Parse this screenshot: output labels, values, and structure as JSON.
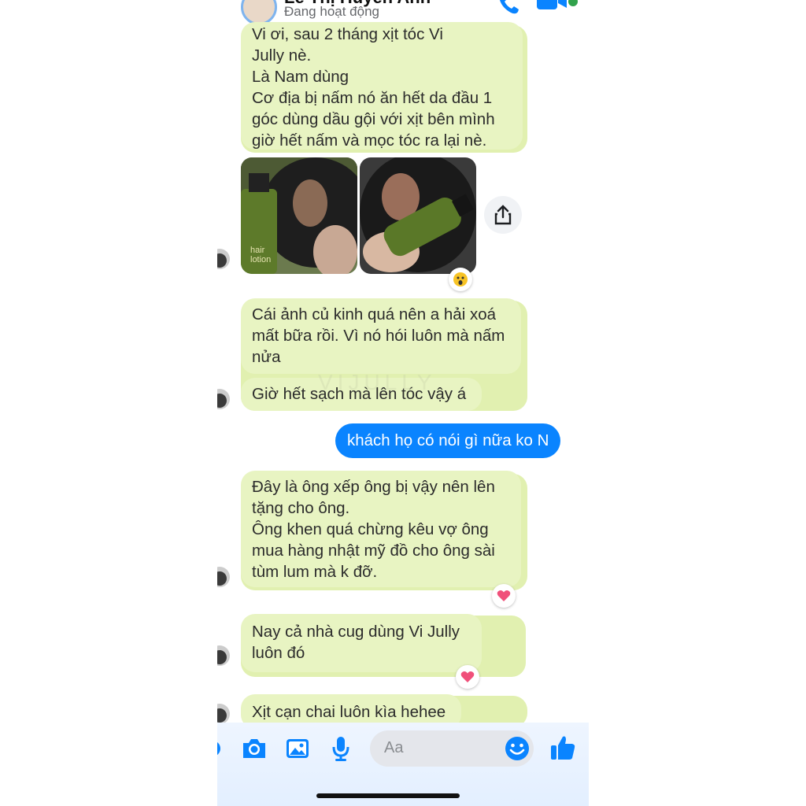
{
  "header": {
    "contact_name": "Lê Thị Huyền Anh",
    "status": "Đang hoạt động"
  },
  "messages": {
    "m1": [
      "Vi ơi, sau 2 tháng xịt tóc Vi",
      "Jully nè.",
      "Là Nam dùng",
      "Cơ địa bị nấm nó ăn hết da đầu 1",
      "góc dùng dầu gội với xịt bên mình",
      "giờ hết nấm và mọc tóc ra lại nè."
    ],
    "m2": [
      "Cái ảnh củ kinh quá nên a hải xoá",
      "mất bữa rồi. Vì nó hói luôn mà nấm",
      "nửa"
    ],
    "m3": "Giờ hết sạch mà lên tóc vậy á",
    "sent": "khách họ có nói gì nữa ko N",
    "m4": [
      "Đây là ông xếp ông bị vậy nên lên",
      "tặng cho ông.",
      "Ông khen quá chừng kêu vợ ông",
      "mua hàng nhật mỹ đồ cho ông sài",
      "tùm lum mà k đỡ."
    ],
    "m5": [
      "Nay cả nhà cug dùng Vi Jully",
      "luôn đó"
    ],
    "m6": "Xịt cạn chai luôn kìa hehee"
  },
  "photos": {
    "left_bottle_text": [
      "hair",
      "lotion"
    ]
  },
  "watermark": "VIJULLY",
  "composer": {
    "placeholder": "Aa"
  },
  "colors": {
    "received_bubble": "#e8f4c2",
    "sent_bubble": "#0a84ff",
    "messenger_blue": "#0a84ff"
  },
  "icons": {
    "call": "phone-icon",
    "video": "video-icon",
    "share": "share-icon",
    "camera": "camera-icon",
    "gallery": "image-icon",
    "mic": "microphone-icon",
    "emoji": "smile-icon",
    "like": "thumbs-up-icon"
  }
}
